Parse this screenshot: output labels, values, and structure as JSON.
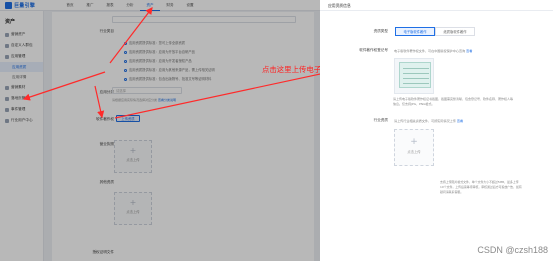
{
  "brand": {
    "name": "巨量引擎"
  },
  "nav": [
    {
      "label": "首页",
      "active": false
    },
    {
      "label": "推广",
      "active": false
    },
    {
      "label": "报表",
      "active": false
    },
    {
      "label": "分析",
      "active": false
    },
    {
      "label": "资产",
      "active": true
    },
    {
      "label": "财务",
      "active": false
    },
    {
      "label": "设置",
      "active": false
    }
  ],
  "sidebar": {
    "title": "资产",
    "items": [
      {
        "label": "营销资产",
        "kind": "item"
      },
      {
        "label": "自定义人群包",
        "kind": "item"
      },
      {
        "label": "应用管理",
        "kind": "item"
      },
      {
        "label": "应用资质",
        "kind": "sub-active"
      },
      {
        "label": "应用详情",
        "kind": "sub"
      },
      {
        "label": "营销素材",
        "kind": "item"
      },
      {
        "label": "落地页管理",
        "kind": "item"
      },
      {
        "label": "事件管理",
        "kind": "item"
      },
      {
        "label": "行业用户中心",
        "kind": "item"
      }
    ]
  },
  "form": {
    "access_label": "行业类目",
    "options": [
      "应用资质提供标准：您可上传全部资质",
      "应用资质提供标准：应用为开放平台自研产品",
      "应用资质提供标准：应用为开发者授权产品",
      "应用资质提供标准：应用为其他来源产品，需上传相关证明",
      "应用资质提供标准：包含出版物号、批准文号等证明材料"
    ],
    "category_label": "应用分类",
    "category_placeholder": "请选择",
    "category_hint": "请根据应用实际情况选择对应分类",
    "category_link": "查看分类说明",
    "copyright_label": "软件著作权",
    "copyright_button": "上传资质",
    "license_label": "营业执照",
    "license_upload": "点击上传",
    "other_label": "其他资质",
    "other_upload": "点击上传",
    "extra_label": "授权证明文件"
  },
  "annotation": {
    "text": "点击这里上传电子版权的截图"
  },
  "drawer": {
    "title": "应用资质信息",
    "type_label": "资质类型",
    "type_options": [
      {
        "label": "电子版软件著作",
        "active": true
      },
      {
        "label": "纸质版软件著作",
        "active": false
      }
    ],
    "copyright_label": "软件著作权登记号",
    "copyright_hint": "电子版软件著作权文件，可在中国版权保护中心查询",
    "copyright_link": "查看",
    "sample_note": "请上传电子版软件著作权证书截图，截图需完整清晰，包含登记号、软件名称、著作权人等信息。仅支持JPG、PNG格式。",
    "industry_label": "行业资质",
    "industry_hint": "请上传行业相关资质文件，可按实际情况上传",
    "industry_link": "查看",
    "upload_text": "点击上传",
    "upload_desc": "支持上传图片格式文件，单个文件大小不超过5MB，最多上传10个文件，上传后需等待审核，审核通过后方可投放广告，如有疑问请联系客服。"
  },
  "watermark": "CSDN @czsh188",
  "colors": {
    "accent": "#1f6fe5",
    "annotation": "#ff1f1f"
  }
}
